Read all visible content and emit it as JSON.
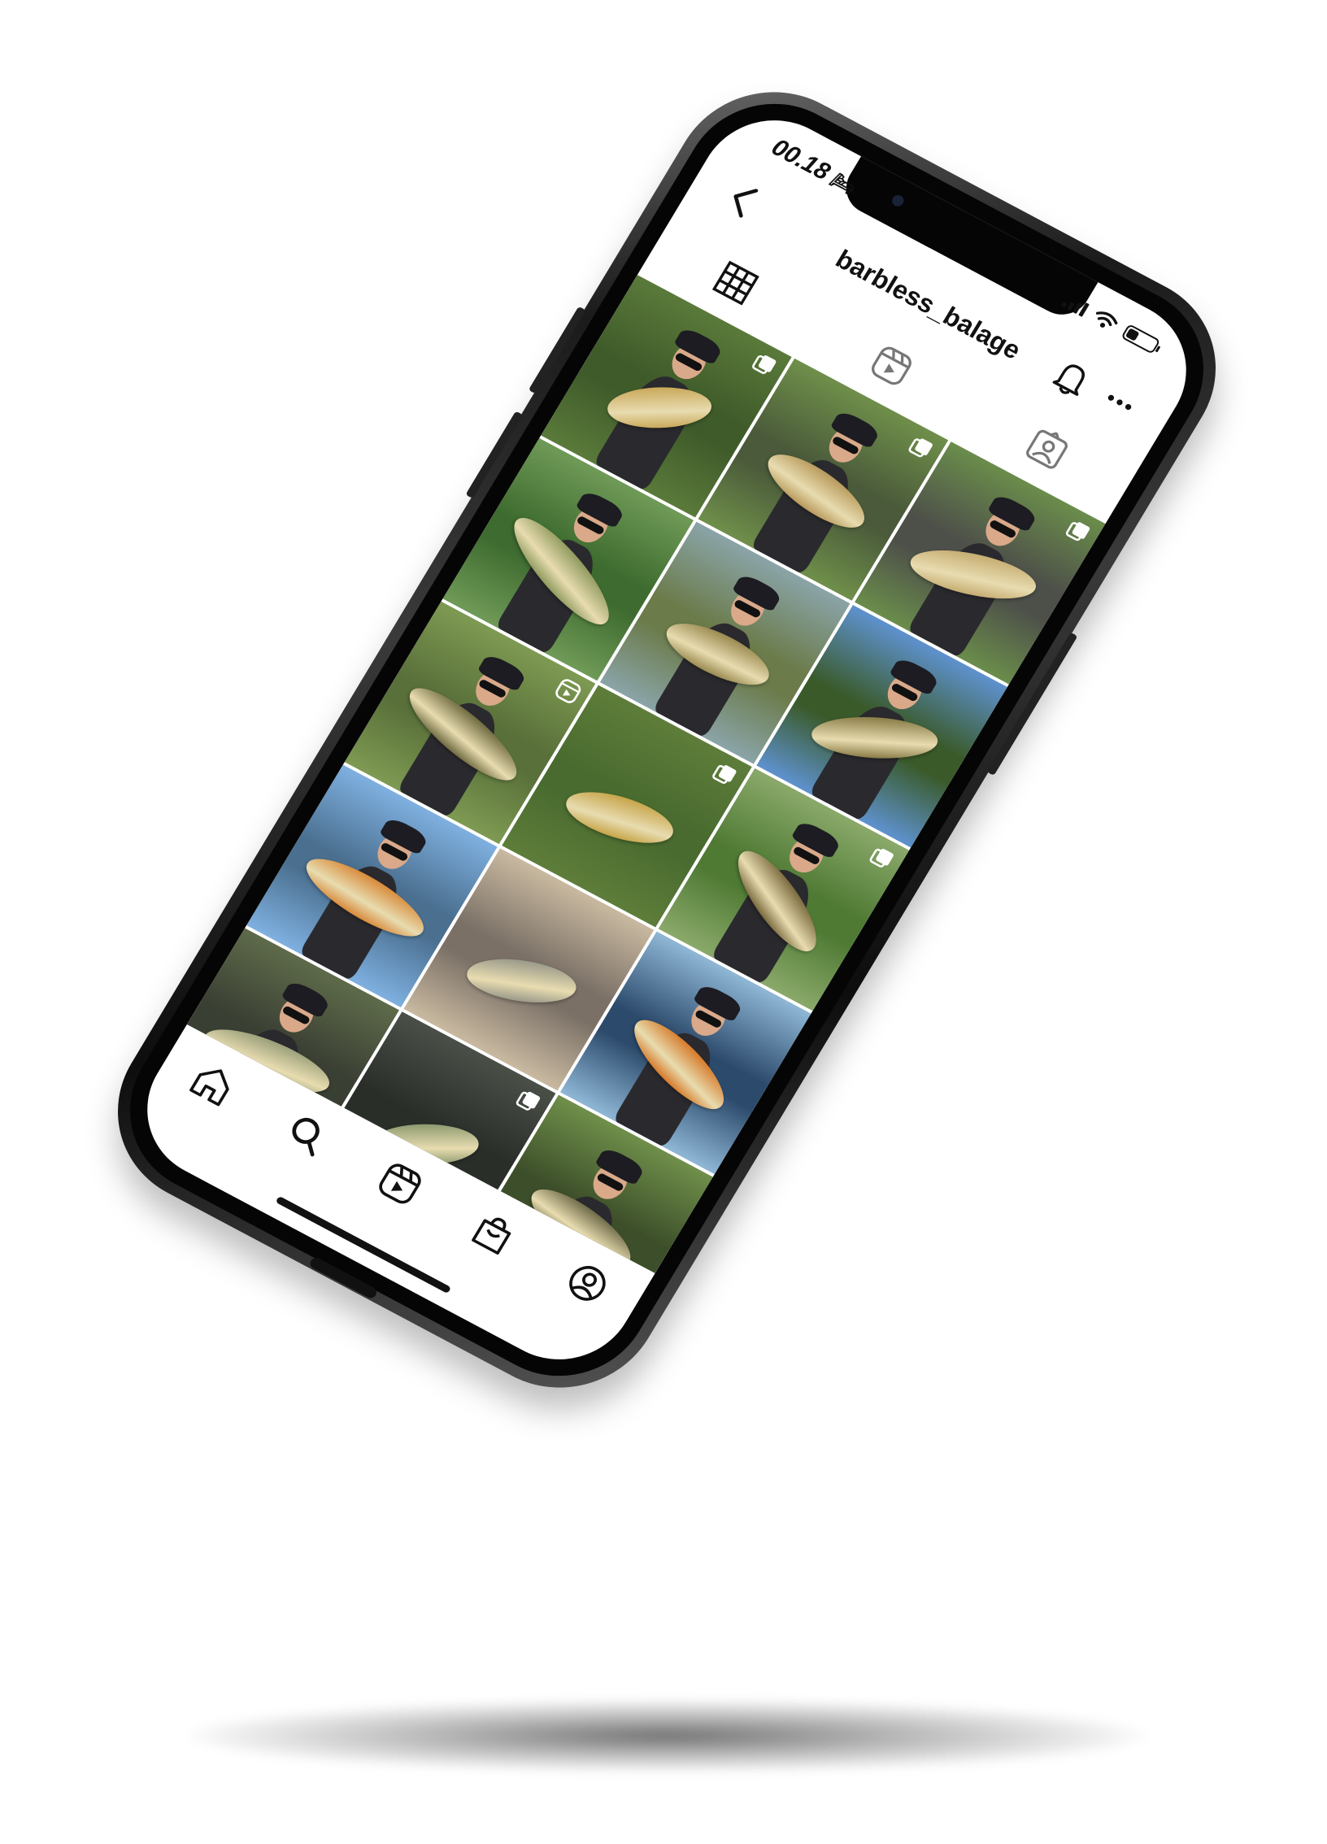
{
  "status_bar": {
    "time": "00.18",
    "focus_icon": "bed-icon",
    "signal_icon": "cellular-signal-icon",
    "wifi_icon": "wifi-icon",
    "battery_level": 0.35
  },
  "header": {
    "username": "barbless_balage",
    "back_icon": "chevron-left-icon",
    "notifications_icon": "bell-icon",
    "more_icon": "more-horizontal-icon"
  },
  "tabs": [
    {
      "name": "posts",
      "icon": "grid-icon",
      "active": true
    },
    {
      "name": "reels",
      "icon": "reels-icon",
      "active": false
    },
    {
      "name": "tagged",
      "icon": "tagged-person-icon",
      "active": false
    }
  ],
  "posts": [
    {
      "subject": "chub",
      "badge": "multiple-photos-icon",
      "palette": [
        "#5a7a3a",
        "#3f5b2a",
        "#c9a85a"
      ]
    },
    {
      "subject": "chub",
      "badge": "multiple-photos-icon",
      "palette": [
        "#6f8f4a",
        "#4a5a3a",
        "#b89a5c"
      ]
    },
    {
      "subject": "chub",
      "badge": "multiple-photos-icon",
      "palette": [
        "#6a8d4b",
        "#4d4f49",
        "#c6ad72"
      ]
    },
    {
      "subject": "pike",
      "badge": "",
      "palette": [
        "#6f9a57",
        "#3e6b2f",
        "#8f9a5e"
      ]
    },
    {
      "subject": "pike",
      "badge": "",
      "palette": [
        "#8aa4a8",
        "#6b7b4a",
        "#9a8a50"
      ]
    },
    {
      "subject": "pike",
      "badge": "",
      "palette": [
        "#5e92cf",
        "#3a5a2a",
        "#8a7d48"
      ]
    },
    {
      "subject": "catfish",
      "badge": "reels-icon",
      "palette": [
        "#7e9a52",
        "#59703a",
        "#6f6a40"
      ]
    },
    {
      "subject": "trophy",
      "badge": "multiple-photos-icon",
      "palette": [
        "#5e7d3a",
        "#496b2f",
        "#c7a54a"
      ]
    },
    {
      "subject": "pike",
      "badge": "multiple-photos-icon",
      "palette": [
        "#8aa96a",
        "#4f7a34",
        "#7a6a3e"
      ]
    },
    {
      "subject": "perch",
      "badge": "",
      "palette": [
        "#7fb0e0",
        "#4a6f8f",
        "#d88a3a"
      ]
    },
    {
      "subject": "zander",
      "badge": "",
      "palette": [
        "#c9b9a0",
        "#7a7066",
        "#9a9a8a"
      ]
    },
    {
      "subject": "perch",
      "badge": "",
      "palette": [
        "#8fb7d6",
        "#2c4a6b",
        "#d67a2a"
      ]
    },
    {
      "subject": "pike",
      "badge": "",
      "palette": [
        "#5e6b4a",
        "#3a3f33",
        "#9aa07a"
      ]
    },
    {
      "subject": "pike",
      "badge": "multiple-photos-icon",
      "palette": [
        "#4a4f48",
        "#2a2e29",
        "#8e9a70"
      ]
    },
    {
      "subject": "catfish",
      "badge": "",
      "palette": [
        "#6f8f4a",
        "#3d4f2a",
        "#6e6a48"
      ]
    }
  ],
  "bottom_nav": [
    {
      "name": "home",
      "icon": "home-icon"
    },
    {
      "name": "search",
      "icon": "search-icon"
    },
    {
      "name": "reels",
      "icon": "reels-icon"
    },
    {
      "name": "shop",
      "icon": "shopping-bag-icon"
    },
    {
      "name": "profile",
      "icon": "profile-icon"
    }
  ]
}
